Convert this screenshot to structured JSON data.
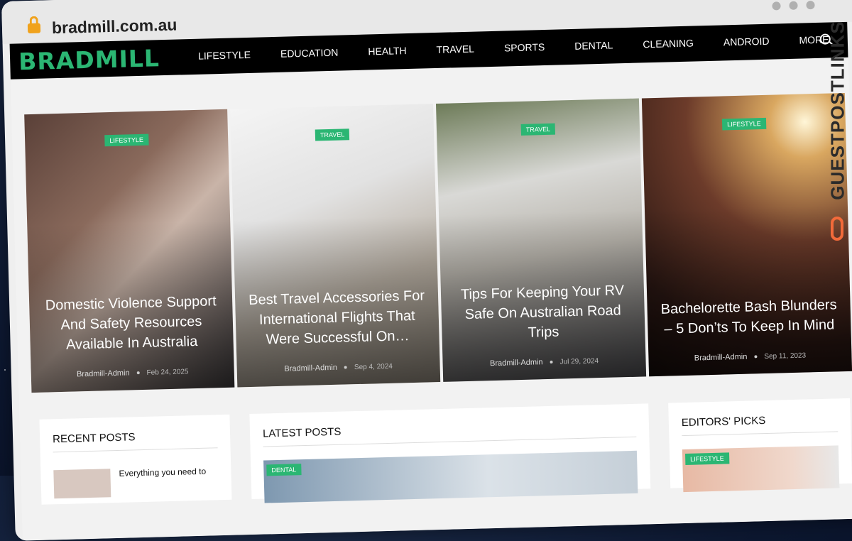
{
  "browser": {
    "url": "bradmill.com.au"
  },
  "site": {
    "logo": "BRADMILL",
    "nav": [
      "LIFESTYLE",
      "EDUCATION",
      "HEALTH",
      "TRAVEL",
      "SPORTS",
      "DENTAL",
      "CLEANING",
      "ANDROID",
      "MORE"
    ],
    "featured": [
      {
        "tag": "LIFESTYLE",
        "title": "Domestic Violence Support And Safety Resources Available In  Australia",
        "author": "Bradmill-Admin",
        "date": "Feb 24, 2025"
      },
      {
        "tag": "TRAVEL",
        "title": "Best Travel Accessories For International Flights That Were Successful On…",
        "author": "Bradmill-Admin",
        "date": "Sep 4, 2024"
      },
      {
        "tag": "TRAVEL",
        "title": "Tips For Keeping Your RV Safe On Australian Road Trips",
        "author": "Bradmill-Admin",
        "date": "Jul 29, 2024"
      },
      {
        "tag": "LIFESTYLE",
        "title": "Bachelorette Bash Blunders – 5 Don’ts To Keep In Mind",
        "author": "Bradmill-Admin",
        "date": "Sep 11, 2023"
      }
    ],
    "recent_posts": {
      "title": "RECENT POSTS",
      "first_item": "Everything you need to"
    },
    "latest_posts": {
      "title": "LATEST POSTS",
      "first_tag": "DENTAL"
    },
    "editors_picks": {
      "title": "EDITORS' PICKS",
      "first_tag": "LIFESTYLE"
    }
  },
  "watermark": "GUESTPOSTLINKS",
  "colors": {
    "accent": "#2bb673",
    "nav_bg": "#000000",
    "watermark": "#2b2b2b",
    "watermark_icon": "#f26a3a"
  }
}
